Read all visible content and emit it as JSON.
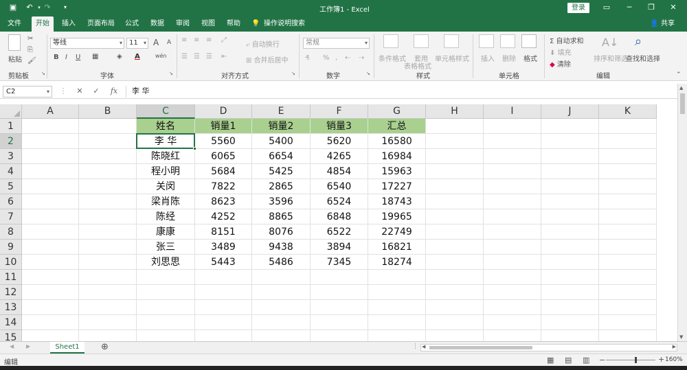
{
  "titlebar": {
    "doc_title": "工作簿1 - Excel",
    "login": "登录",
    "save_icon": "save-icon",
    "undo_icon": "undo-icon",
    "redo_icon": "redo-icon",
    "customize_icon": "chevron-down-icon"
  },
  "tabs": [
    "文件",
    "开始",
    "插入",
    "页面布局",
    "公式",
    "数据",
    "审阅",
    "视图",
    "帮助",
    "操作说明搜索"
  ],
  "share": "共享",
  "ribbon": {
    "clipboard": {
      "paste": "粘贴",
      "label": "剪贴板"
    },
    "font": {
      "name": "等线",
      "size": "11",
      "bold": "B",
      "italic": "I",
      "underline": "U",
      "grow": "A",
      "shrink": "A",
      "label": "字体",
      "wen": "wén"
    },
    "align": {
      "wrap": "自动换行",
      "merge": "合并后居中",
      "label": "对齐方式"
    },
    "number": {
      "format": "常规",
      "label": "数字",
      "percent": "%",
      "comma": ","
    },
    "styles": {
      "cond": "条件格式",
      "table": "套用",
      "table2": "表格格式",
      "cell": "单元格样式",
      "label": "样式"
    },
    "cells": {
      "insert": "插入",
      "delete": "删除",
      "format": "格式",
      "label": "单元格"
    },
    "editing": {
      "autosum": "自动求和",
      "fill": "填充",
      "clear": "清除",
      "sort": "排序和筛选",
      "find": "查找和选择",
      "label": "编辑"
    }
  },
  "formula_bar": {
    "name_box": "C2",
    "fx": "fx",
    "content": "李 华"
  },
  "columns": [
    "A",
    "B",
    "C",
    "D",
    "E",
    "F",
    "G",
    "H",
    "I",
    "J",
    "K"
  ],
  "rows": [
    "1",
    "2",
    "3",
    "4",
    "5",
    "6",
    "7",
    "8",
    "9",
    "10",
    "11",
    "12",
    "13",
    "14",
    "15"
  ],
  "table": {
    "header": [
      "姓名",
      "销量1",
      "销量2",
      "销量3",
      "汇总"
    ],
    "rows": [
      [
        "李  华",
        "5560",
        "5400",
        "5620",
        "16580"
      ],
      [
        "陈晓红",
        "6065",
        "6654",
        "4265",
        "16984"
      ],
      [
        "程小明",
        "5684",
        "5425",
        "4854",
        "15963"
      ],
      [
        "关闵",
        "7822",
        "2865",
        "6540",
        "17227"
      ],
      [
        "梁肖陈",
        "8623",
        "3596",
        "6524",
        "18743"
      ],
      [
        "陈经",
        "4252",
        "8865",
        "6848",
        "19965"
      ],
      [
        "康康",
        "8151",
        "8076",
        "6522",
        "22749"
      ],
      [
        "张三",
        "3489",
        "9438",
        "3894",
        "16821"
      ],
      [
        "刘思思",
        "5443",
        "5486",
        "7345",
        "18274"
      ]
    ]
  },
  "sheet": {
    "tab": "Sheet1",
    "add": "⊕"
  },
  "status": {
    "mode": "编辑",
    "zoom": "160%"
  },
  "colors": {
    "accent": "#217346",
    "header_fill": "#a9d08e"
  }
}
